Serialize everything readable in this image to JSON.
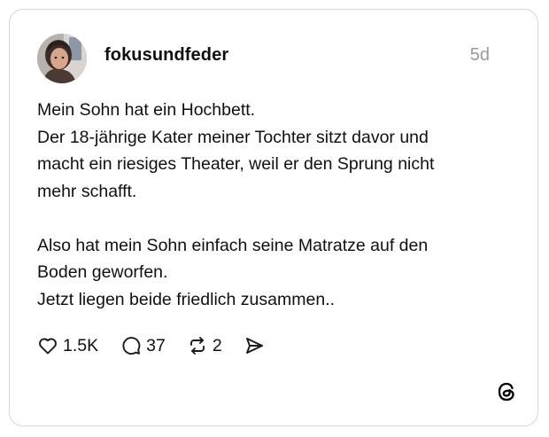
{
  "post": {
    "username": "fokusundfeder",
    "time": "5d",
    "lines": [
      "Mein Sohn hat ein Hochbett.",
      "Der 18-jährige Kater meiner Tochter sitzt davor und",
      "macht ein riesiges Theater, weil er den Sprung nicht",
      "mehr schafft.",
      "Also hat mein Sohn einfach seine Matratze auf den",
      "Boden geworfen.",
      "Jetzt liegen beide friedlich zusammen.."
    ]
  },
  "actions": {
    "likes": "1.5K",
    "replies": "37",
    "reposts": "2"
  },
  "icons": {
    "like": "heart-icon",
    "reply": "speech-bubble-icon",
    "repost": "repost-arrows-icon",
    "share": "send-icon",
    "brand": "threads-logo-icon"
  }
}
